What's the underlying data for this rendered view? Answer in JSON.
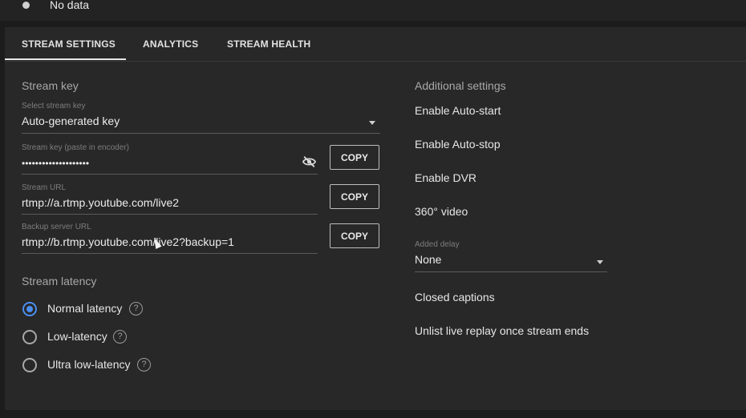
{
  "status": {
    "text": "No data"
  },
  "tabs": [
    {
      "label": "STREAM SETTINGS",
      "active": true
    },
    {
      "label": "ANALYTICS",
      "active": false
    },
    {
      "label": "STREAM HEALTH",
      "active": false
    }
  ],
  "stream_key": {
    "title": "Stream key",
    "select": {
      "label": "Select stream key",
      "value": "Auto-generated key"
    },
    "key": {
      "label": "Stream key (paste in encoder)",
      "value": "••••••••••••••••••••",
      "copy_label": "COPY"
    },
    "url": {
      "label": "Stream URL",
      "value": "rtmp://a.rtmp.youtube.com/live2",
      "copy_label": "COPY"
    },
    "backup": {
      "label": "Backup server URL",
      "value": "rtmp://b.rtmp.youtube.com/live2?backup=1",
      "copy_label": "COPY"
    }
  },
  "latency": {
    "title": "Stream latency",
    "options": [
      {
        "label": "Normal latency",
        "selected": true
      },
      {
        "label": "Low-latency",
        "selected": false
      },
      {
        "label": "Ultra low-latency",
        "selected": false
      }
    ],
    "help_glyph": "?"
  },
  "additional": {
    "title": "Additional settings",
    "auto_start": "Enable Auto-start",
    "auto_stop": "Enable Auto-stop",
    "dvr": "Enable DVR",
    "video_360": "360° video",
    "delay": {
      "label": "Added delay",
      "value": "None"
    },
    "captions": "Closed captions",
    "unlist": "Unlist live replay once stream ends"
  },
  "colors": {
    "accent": "#4a8ef0",
    "background": "#1c1c1c",
    "panel": "#282828"
  }
}
